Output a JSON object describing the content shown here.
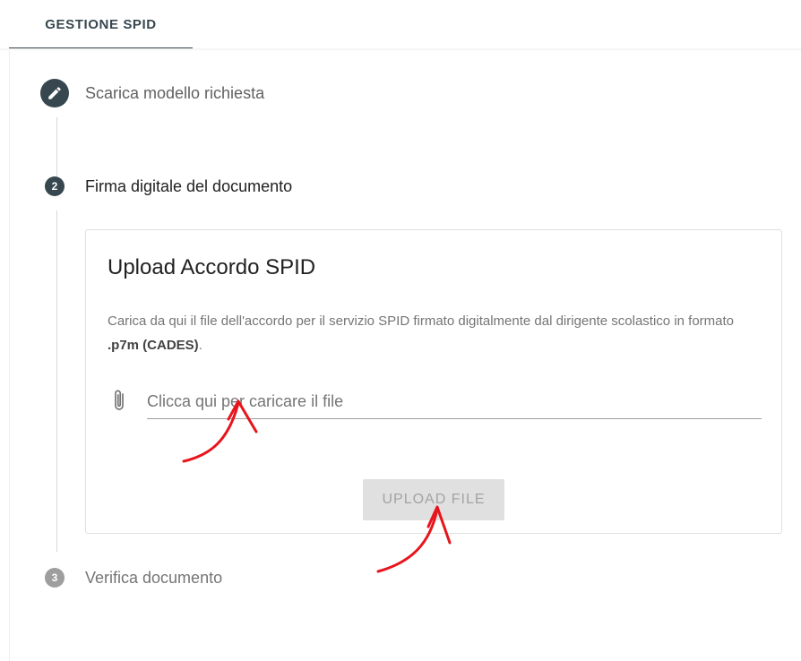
{
  "tabs": [
    {
      "label": "GESTIONE SPID",
      "active": true
    }
  ],
  "stepper": {
    "steps": [
      {
        "number": "",
        "icon": "pencil-icon",
        "label": "Scarica modello richiesta",
        "state": "done"
      },
      {
        "number": "2",
        "label": "Firma digitale del documento",
        "state": "active"
      },
      {
        "number": "3",
        "label": "Verifica documento",
        "state": "pending"
      }
    ]
  },
  "card": {
    "title": "Upload Accordo SPID",
    "desc_prefix": "Carica da qui il file dell'accordo per il servizio SPID firmato digitalmente dal dirigente scolastico in formato ",
    "desc_format": ".p7m (CADES)",
    "desc_suffix": ".",
    "file_placeholder": "Clicca qui per caricare il file",
    "file_icon": "paperclip-icon",
    "upload_label": "UPLOAD FILE"
  },
  "colors": {
    "primary": "#37474f",
    "inactive_step": "#9e9e9e",
    "annotation": "#e8141b",
    "button_disabled_bg": "#e0e0e0"
  }
}
